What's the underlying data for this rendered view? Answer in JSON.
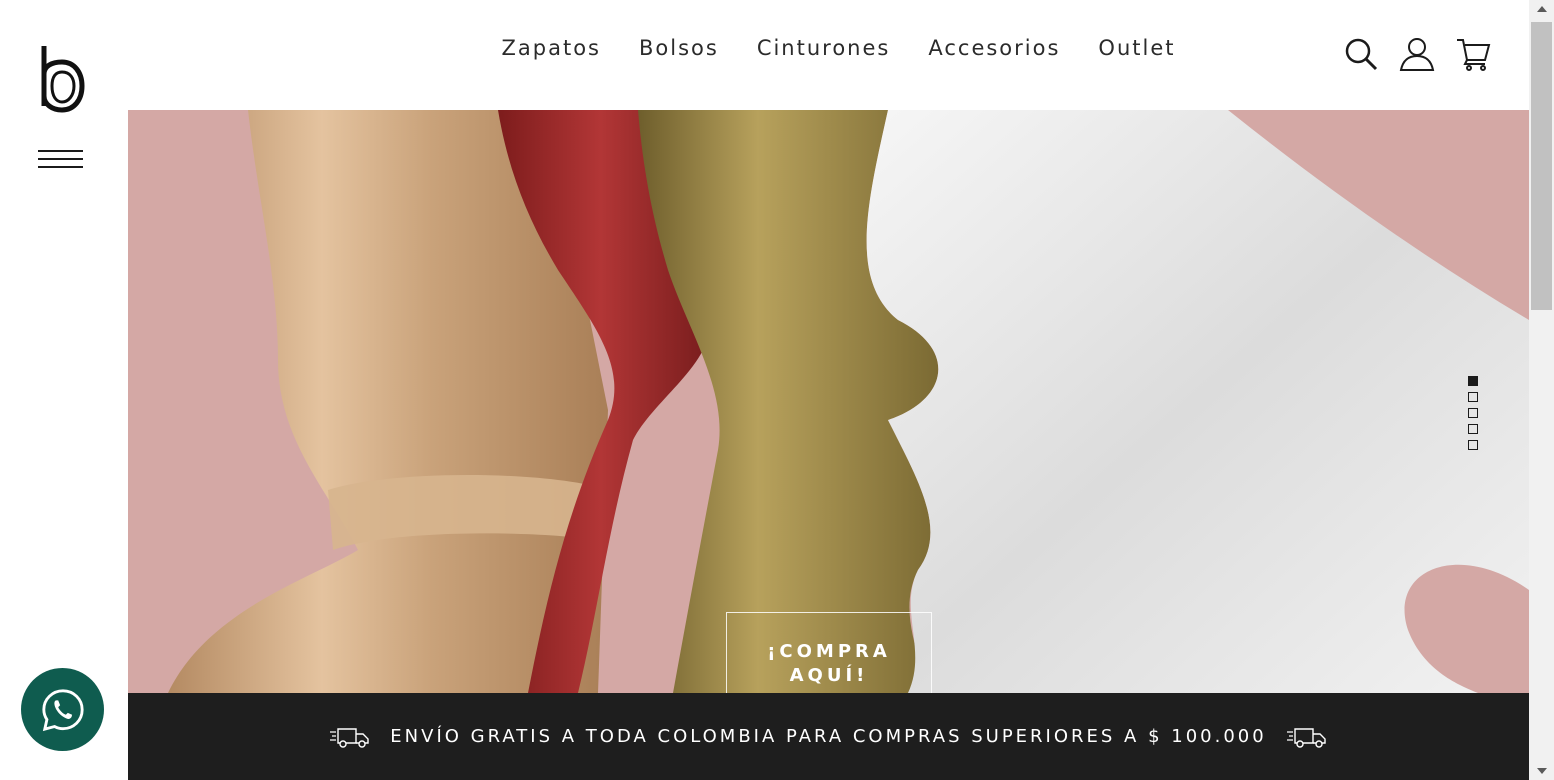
{
  "brand": {
    "logo_icon": "b-monogram-logo"
  },
  "nav": {
    "items": [
      {
        "label": "Zapatos"
      },
      {
        "label": "Bolsos"
      },
      {
        "label": "Cinturones"
      },
      {
        "label": "Accesorios"
      },
      {
        "label": "Outlet"
      }
    ]
  },
  "header_icons": [
    "search-icon",
    "user-icon",
    "cart-icon"
  ],
  "hero": {
    "cta_label": "¡COMPRA AQUÍ!",
    "slides_total": 5,
    "active_slide": 1,
    "colors": {
      "background": "#d4a8a5",
      "rose_gold": "#c9a27a",
      "red": "#9c2a2a",
      "olive_gold": "#8f7d42",
      "white": "#eeeeee"
    }
  },
  "shipping_bar": {
    "text": "ENVÍO GRATIS A TODA COLOMBIA PARA COMPRAS SUPERIORES A $ 100.000",
    "icon": "delivery-truck-icon"
  },
  "floating": {
    "whatsapp_icon": "whatsapp-icon",
    "color": "#0f5c4f"
  }
}
